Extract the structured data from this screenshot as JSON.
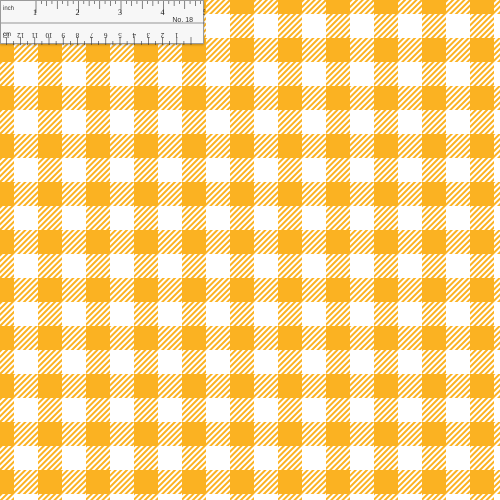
{
  "fabric": {
    "pattern": "gingham",
    "colors": {
      "main": "#fbb222",
      "light": "#fff4d6",
      "base": "#ffffff"
    }
  },
  "ruler": {
    "inch_unit": "inch",
    "cm_unit": "cm",
    "inch_labels": [
      "1",
      "2",
      "3",
      "4",
      "5"
    ],
    "cm_labels": [
      "1",
      "2",
      "3",
      "4",
      "5",
      "6",
      "7",
      "8",
      "9",
      "10",
      "11",
      "12",
      "13"
    ],
    "number_label": "No. 18"
  }
}
